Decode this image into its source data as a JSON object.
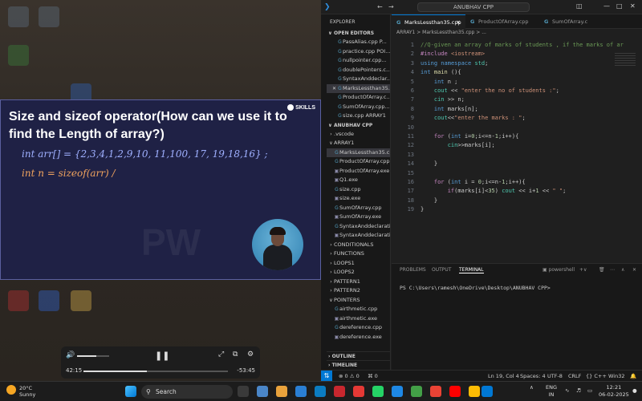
{
  "video": {
    "title": "Size and sizeof operator(How can we use it to find the Length of array?)",
    "logo": "SKILLS",
    "line1": "int arr[] = {2,3,4,1,2,9,10, 11,100, 17, 19,18,16} ;",
    "line2": "int n = sizeof(arr) /",
    "watermark": "PW"
  },
  "media": {
    "elapsed": "42:15",
    "remaining": "-53:45",
    "progress": 0.44,
    "volume": 0.6,
    "volume_icon": "🔊",
    "play_icon": "❚❚",
    "fullscreen_icon": "⤢",
    "pip_icon": "⧉",
    "settings_icon": "⚙"
  },
  "vscode": {
    "search": "ANUBHAV CPP",
    "explorer_title": "EXPLORER",
    "open_editors_label": "OPEN EDITORS",
    "open_editors": [
      {
        "name": "PassAlias.cpp  P...",
        "icon": "G"
      },
      {
        "name": "practice.cpp  POI...",
        "icon": "G"
      },
      {
        "name": "nullpointer.cpp...",
        "icon": "G"
      },
      {
        "name": "doublePointers.c...",
        "icon": "G"
      },
      {
        "name": "SyntaxAnddeclar...",
        "icon": "G"
      },
      {
        "name": "MarksLessthan35...",
        "icon": "G",
        "selected": true
      },
      {
        "name": "ProductOfArray.c...",
        "icon": "G"
      },
      {
        "name": "SumOfArray.cpp...",
        "icon": "G"
      },
      {
        "name": "size.cpp  ARRAY1",
        "icon": "G"
      }
    ],
    "workspace_label": "ANUBHAV CPP",
    "tree": [
      {
        "name": ".vscode",
        "type": "folder"
      },
      {
        "name": "ARRAY1",
        "type": "open"
      },
      {
        "name": "MarksLessthan35.cpp",
        "type": "cpp",
        "selected": true
      },
      {
        "name": "ProductOfArray.cpp",
        "type": "cpp"
      },
      {
        "name": "ProductOfArray.exe",
        "type": "exe"
      },
      {
        "name": "Q1.exe",
        "type": "exe"
      },
      {
        "name": "size.cpp",
        "type": "cpp"
      },
      {
        "name": "size.exe",
        "type": "exe"
      },
      {
        "name": "SumOfArray.cpp",
        "type": "cpp"
      },
      {
        "name": "SumOfArray.exe",
        "type": "exe"
      },
      {
        "name": "SyntaxAnddeclaratio...",
        "type": "cpp"
      },
      {
        "name": "SyntaxAnddeclaratio...",
        "type": "exe"
      },
      {
        "name": "CONDITIONALS",
        "type": "folder"
      },
      {
        "name": "FUNCTIONS",
        "type": "folder"
      },
      {
        "name": "LOOPS1",
        "type": "folder"
      },
      {
        "name": "LOOPS2",
        "type": "folder"
      },
      {
        "name": "PATTERN1",
        "type": "folder"
      },
      {
        "name": "PATTERN2",
        "type": "folder"
      },
      {
        "name": "POINTERS",
        "type": "open"
      },
      {
        "name": "airthmetic.cpp",
        "type": "cpp"
      },
      {
        "name": "airthmetic.exe",
        "type": "exe"
      },
      {
        "name": "dereference.cpp",
        "type": "cpp"
      },
      {
        "name": "dereference.exe",
        "type": "exe"
      }
    ],
    "outline_label": "OUTLINE",
    "timeline_label": "TIMELINE",
    "tabs": [
      {
        "label": "MarksLessthan35.cpp",
        "active": true
      },
      {
        "label": "ProductOfArray.cpp",
        "active": false
      },
      {
        "label": "SumOfArray.c",
        "active": false
      }
    ],
    "breadcrumb": "ARRAY1 > MarksLessthan35.cpp > ...",
    "code": [
      "//Q-given an array of marks of students , if the marks of ar",
      "#include <iostream>",
      "using namespace std;",
      "int main (){",
      "    int n ;",
      "    cout << \"enter the no of students :\";",
      "    cin >> n;",
      "    int marks[n];",
      "    cout<<\"enter the marks : \";",
      "",
      "    for (int i=0;i<=n-1;i++){",
      "        cin>>marks[i];",
      "",
      "    }",
      "",
      "    for (int i = 0;i<=n-1;i++){",
      "        if(marks[i]<35) cout << i+1 << \" \";",
      "    }",
      "}"
    ],
    "panel_tabs": [
      "PROBLEMS",
      "OUTPUT",
      "TERMINAL"
    ],
    "shell_label": "powershell",
    "terminal": "PS C:\\Users\\ramesh\\OneDrive\\Desktop\\ANUBHAV CPP>",
    "status": {
      "errors": "0",
      "warnings": "0",
      "ports": "0",
      "position": "Ln 19, Col 4",
      "spaces": "Spaces: 4",
      "encoding": "UTF-8",
      "eol": "CRLF",
      "lang": "{} C++",
      "platform": "Win32"
    }
  },
  "taskbar": {
    "temp": "20°C",
    "condition": "Sunny",
    "search": "Search",
    "lang1": "ENG",
    "lang2": "IN",
    "time": "12:21",
    "date": "06-02-2025"
  }
}
